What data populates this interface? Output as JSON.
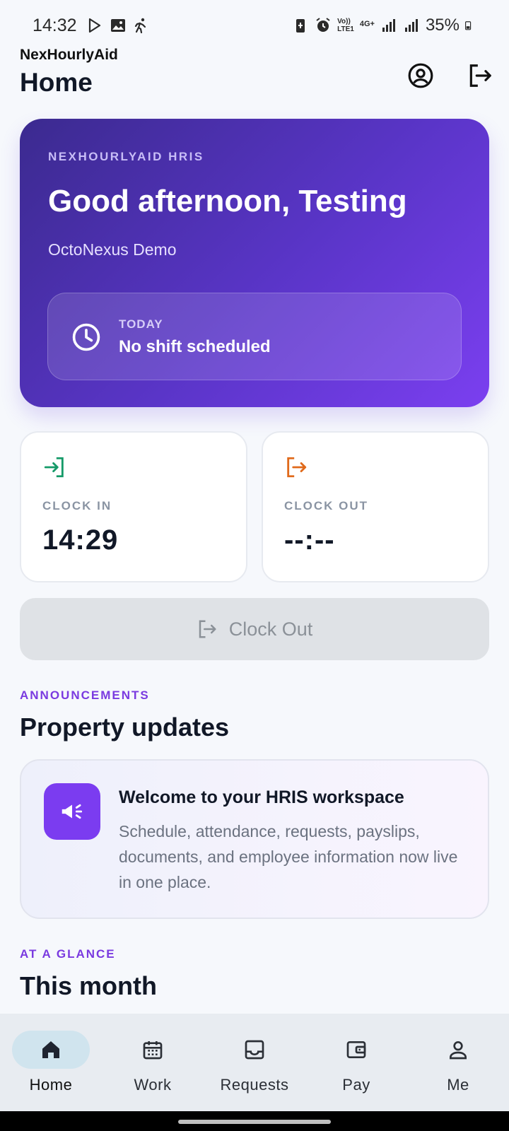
{
  "status_bar": {
    "time": "14:32",
    "network_top": "Vo))",
    "network_bottom": "LTE1",
    "gen": "4G+",
    "battery": "35%"
  },
  "header": {
    "app_name": "NexHourlyAid",
    "page_title": "Home",
    "profile_icon": "account-circle-icon",
    "logout_icon": "logout-icon"
  },
  "hero": {
    "eyebrow": "NEXHOURLYAID HRIS",
    "greeting": "Good afternoon, Testing",
    "org": "OctoNexus Demo",
    "today_label": "TODAY",
    "today_value": "No shift scheduled",
    "today_icon": "clock-icon"
  },
  "clock_in": {
    "label": "CLOCK IN",
    "value": "14:29",
    "icon": "login-icon",
    "color": "#159a68"
  },
  "clock_out": {
    "label": "CLOCK OUT",
    "value": "--:--",
    "icon": "logout-icon",
    "color": "#e06a1b"
  },
  "clock_out_button": {
    "label": "Clock Out",
    "icon": "logout-icon",
    "enabled": false
  },
  "announcements": {
    "eyebrow": "ANNOUNCEMENTS",
    "title": "Property updates",
    "items": [
      {
        "icon": "megaphone-icon",
        "title": "Welcome to your HRIS workspace",
        "body": "Schedule, attendance, requests, payslips, documents, and employee information now live in one place."
      }
    ]
  },
  "glance": {
    "eyebrow": "AT A GLANCE",
    "title": "This month"
  },
  "bottom_nav": {
    "items": [
      {
        "label": "Home",
        "icon": "home-icon",
        "active": true
      },
      {
        "label": "Work",
        "icon": "calendar-icon",
        "active": false
      },
      {
        "label": "Requests",
        "icon": "inbox-icon",
        "active": false
      },
      {
        "label": "Pay",
        "icon": "wallet-icon",
        "active": false
      },
      {
        "label": "Me",
        "icon": "person-icon",
        "active": false
      }
    ]
  },
  "colors": {
    "accent": "#7b3ae0",
    "hero_start": "#3b2a8f",
    "hero_end": "#7b3ff0"
  }
}
